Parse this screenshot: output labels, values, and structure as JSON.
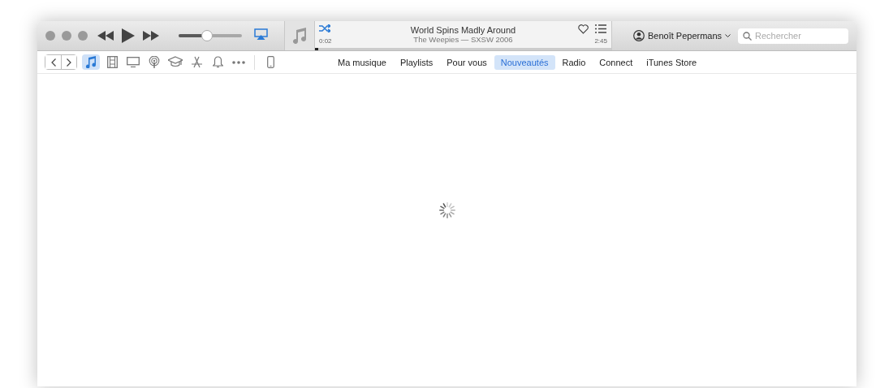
{
  "player": {
    "volume": {
      "level": 0.45
    },
    "shuffle": {
      "on": true
    },
    "track": {
      "title": "World Spins Madly Around",
      "subtitle": "The Weepies — SXSW 2006",
      "elapsed": "0:02",
      "duration": "2:45",
      "progress": {
        "level": 0.01
      }
    }
  },
  "account": {
    "name": "Benoît Pepermans"
  },
  "search": {
    "placeholder": "Rechercher"
  },
  "media_types": [
    {
      "kind": "music",
      "selected": true
    },
    {
      "kind": "movies",
      "selected": false
    },
    {
      "kind": "tv",
      "selected": false
    },
    {
      "kind": "podcasts",
      "selected": false
    },
    {
      "kind": "itunesu",
      "selected": false
    },
    {
      "kind": "apps",
      "selected": false
    },
    {
      "kind": "tones",
      "selected": false
    },
    {
      "kind": "more",
      "selected": false
    },
    {
      "kind": "device",
      "selected": false
    }
  ],
  "tabs": [
    {
      "label": "Ma musique",
      "selected": false
    },
    {
      "label": "Playlists",
      "selected": false
    },
    {
      "label": "Pour vous",
      "selected": false
    },
    {
      "label": "Nouveautés",
      "selected": true
    },
    {
      "label": "Radio",
      "selected": false
    },
    {
      "label": "Connect",
      "selected": false
    },
    {
      "label": "iTunes Store",
      "selected": false
    }
  ],
  "content": {
    "loading": true
  }
}
